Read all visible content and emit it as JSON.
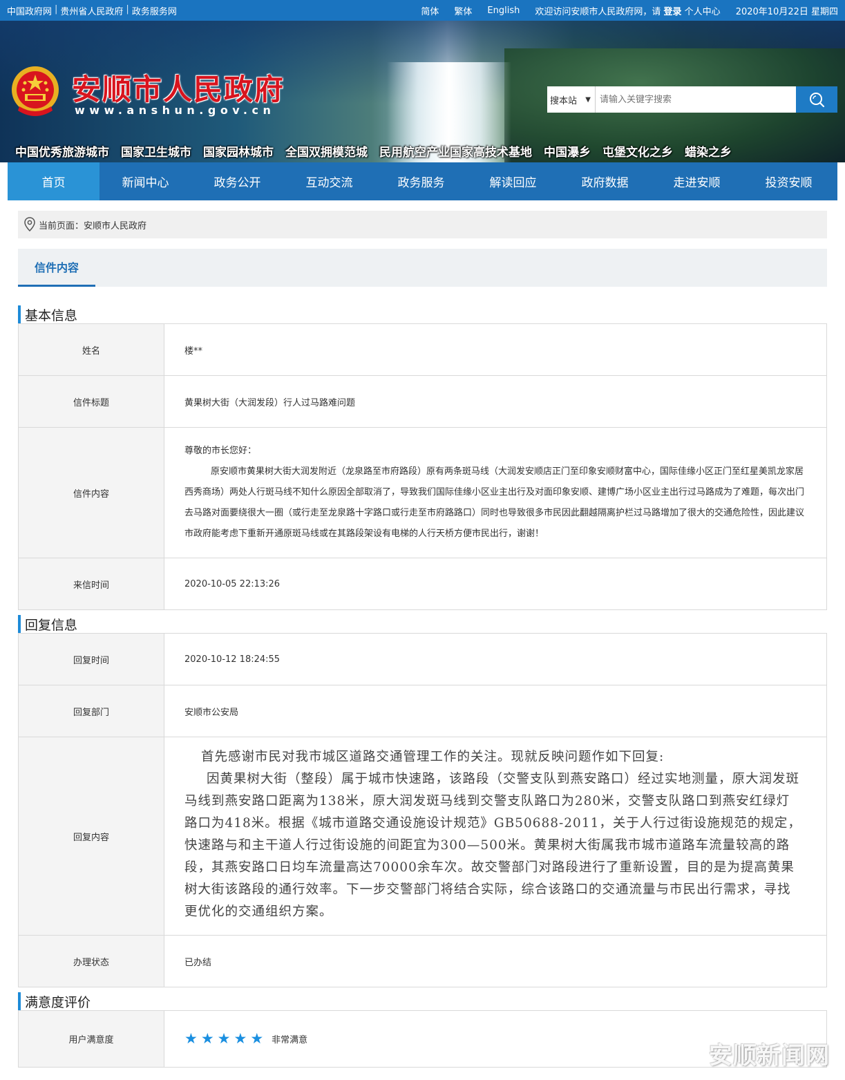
{
  "topbar": {
    "links": [
      "中国政府网",
      "贵州省人民政府",
      "政务服务网"
    ],
    "lang": [
      "简体",
      "繁体",
      "English"
    ],
    "welcome": "欢迎访问安顺市人民政府网，请",
    "login": "登录",
    "personal": "个人中心",
    "date": "2020年10月22日 星期四"
  },
  "header": {
    "title": "安顺市人民政府",
    "url": "www.anshun.gov.cn",
    "search_scope": "搜本站",
    "search_placeholder": "请输入关键字搜索",
    "honors": [
      "中国优秀旅游城市",
      "国家卫生城市",
      "国家园林城市",
      "全国双拥模范城",
      "民用航空产业国家高技术基地",
      "中国瀑乡",
      "屯堡文化之乡",
      "蜡染之乡"
    ]
  },
  "nav": [
    "首页",
    "新闻中心",
    "政务公开",
    "互动交流",
    "政务服务",
    "解读回应",
    "政府数据",
    "走进安顺",
    "投资安顺"
  ],
  "breadcrumb": {
    "prefix": "当前页面：",
    "current": "安顺市人民政府"
  },
  "tab": "信件内容",
  "basic": {
    "title": "基本信息",
    "name_label": "姓名",
    "name": "楼**",
    "subject_label": "信件标题",
    "subject": "黄果树大街（大润发段）行人过马路难问题",
    "content_label": "信件内容",
    "greeting": "尊敬的市长您好：",
    "content": "原安顺市黄果树大街大润发附近（龙泉路至市府路段）原有两条斑马线（大润发安顺店正门至印象安顺财富中心，国际佳缘小区正门至红星美凯龙家居西秀商场）两处人行斑马线不知什么原因全部取消了，导致我们国际佳缘小区业主出行及对面印象安顺、建博广场小区业主出行过马路成为了难题，每次出门去马路对面要绕很大一圈（或行走至龙泉路十字路口或行走至市府路路口）同时也导致很多市民因此翻越隔离护栏过马路增加了很大的交通危险性，因此建议市政府能考虑下重新开通原斑马线或在其路段架设有电梯的人行天桥方便市民出行，谢谢！",
    "time_label": "来信时间",
    "time": "2020-10-05 22:13:26"
  },
  "reply": {
    "title": "回复信息",
    "time_label": "回复时间",
    "time": "2020-10-12 18:24:55",
    "dept_label": "回复部门",
    "dept": "安顺市公安局",
    "content_label": "回复内容",
    "p1": "首先感谢市民对我市城区道路交通管理工作的关注。现就反映问题作如下回复:",
    "p2": "因黄果树大街（整段）属于城市快速路，该路段（交警支队到燕安路口）经过实地测量，原大润发斑马线到燕安路口距离为138米，原大润发斑马线到交警支队路口为280米，交警支队路口到燕安红绿灯路口为418米。根据《城市道路交通设施设计规范》GB50688-2011，关于人行过街设施规范的规定，快速路与和主干道人行过街设施的间距宜为300—500米。黄果树大街属我市城市道路车流量较高的路段，其燕安路口日均车流量高达70000余车次。故交警部门对路段进行了重新设置，目的是为提高黄果树大街该路段的通行效率。下一步交警部门将结合实际，综合该路口的交通流量与市民出行需求，寻找更优化的交通组织方案。",
    "status_label": "办理状态",
    "status": "已办结"
  },
  "rating": {
    "title": "满意度评价",
    "label": "用户满意度",
    "stars": 5,
    "text": "非常满意"
  },
  "watermark": "安顺新闻网",
  "colors": {
    "primary": "#1f6fb5",
    "accent": "#1e8bd8",
    "title_red": "#d8141e"
  }
}
